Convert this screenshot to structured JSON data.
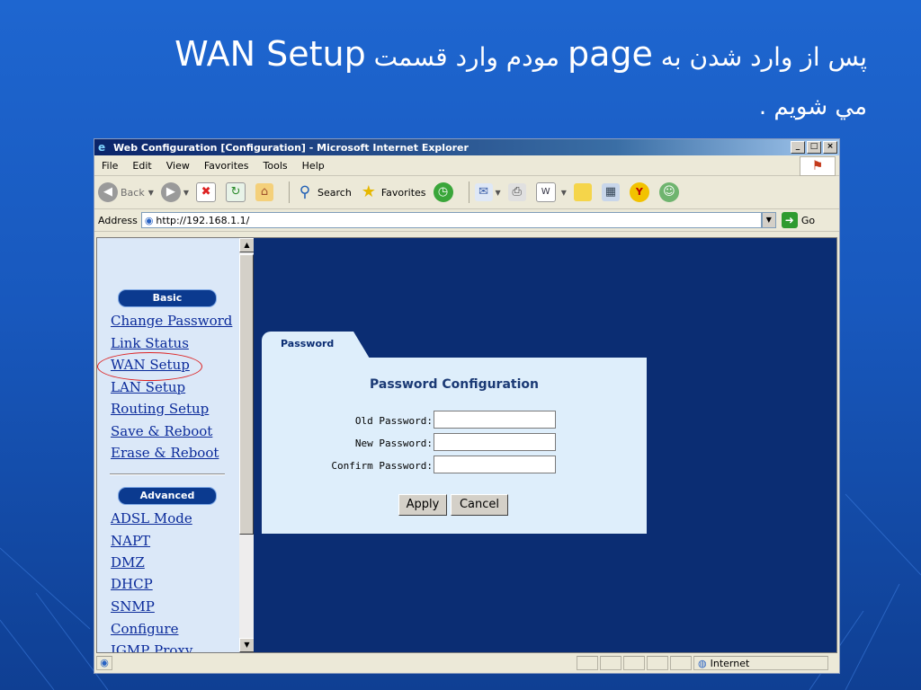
{
  "slide": {
    "title_line1_rtl_prefix": "پس از وارد شدن به",
    "title_word_page": "page",
    "title_line1_mid": "مودم  وارد قسمت",
    "title_word_wan": "WAN Setup",
    "title_line2": "مي شويم ."
  },
  "window": {
    "title": "Web Configuration [Configuration] - Microsoft Internet Explorer",
    "controls": [
      "_",
      "□",
      "×"
    ]
  },
  "menubar": [
    "File",
    "Edit",
    "View",
    "Favorites",
    "Tools",
    "Help"
  ],
  "toolbar": {
    "back_label": "Back",
    "search_label": "Search",
    "favorites_label": "Favorites"
  },
  "address": {
    "label": "Address",
    "url": "http://192.168.1.1/",
    "go_label": "Go"
  },
  "sidebar": {
    "basic_label": "Basic",
    "basic_items": [
      "Change Password",
      "Link Status",
      "WAN Setup",
      "LAN Setup",
      "Routing Setup",
      "Save & Reboot",
      "Erase & Reboot"
    ],
    "advanced_label": "Advanced",
    "advanced_items": [
      "ADSL Mode",
      "NAPT",
      "DMZ",
      "DHCP",
      "SNMP",
      "Configure",
      "IGMP Proxy"
    ]
  },
  "form": {
    "tab_label": "Password",
    "heading": "Password Configuration",
    "fields": [
      {
        "label": "Old Password:",
        "value": ""
      },
      {
        "label": "New Password:",
        "value": ""
      },
      {
        "label": "Confirm Password:",
        "value": ""
      }
    ],
    "apply_label": "Apply",
    "cancel_label": "Cancel"
  },
  "status": {
    "zone_label": "Internet"
  },
  "colors": {
    "slide_bg": "#1858bd",
    "frame_bg": "#0b2d73",
    "sidebar_bg": "#dbe8f8",
    "panel_bg": "#deeefb",
    "highlight_circle": "#dd2222"
  }
}
